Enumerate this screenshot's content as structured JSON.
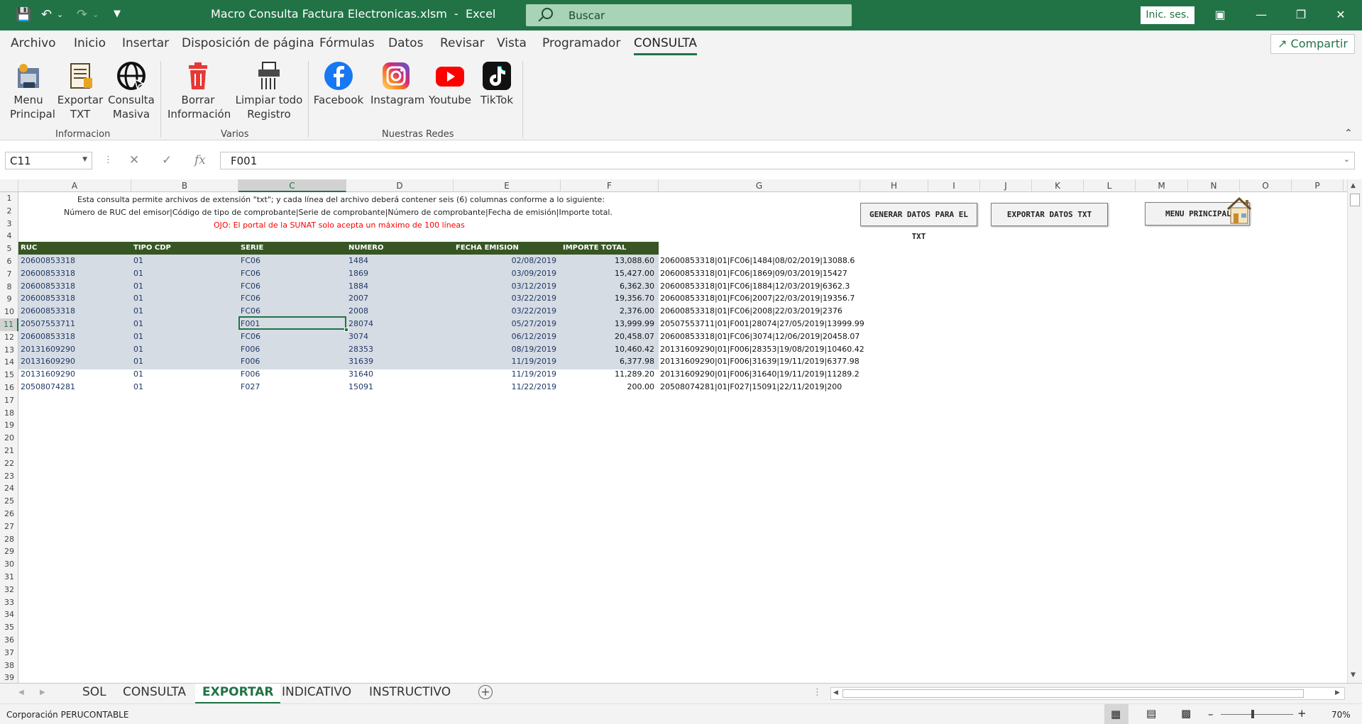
{
  "titlebar": {
    "filename": "Macro Consulta Factura Electronicas.xlsm",
    "separator": "-",
    "app": "Excel",
    "search_placeholder": "Buscar",
    "signin": "Inic. ses."
  },
  "menu": {
    "items": [
      "Archivo",
      "Inicio",
      "Insertar",
      "Disposición de página",
      "Fórmulas",
      "Datos",
      "Revisar",
      "Vista",
      "Programador",
      "CONSULTA"
    ],
    "share": "Compartir"
  },
  "ribbon": {
    "buttons": [
      {
        "l1": "Menu",
        "l2": "Principal"
      },
      {
        "l1": "Exportar",
        "l2": "TXT"
      },
      {
        "l1": "Consulta",
        "l2": "Masiva"
      },
      {
        "l1": "Borrar",
        "l2": "Información"
      },
      {
        "l1": "Limpiar todo",
        "l2": "Registro"
      },
      {
        "l1": "Facebook",
        "l2": ""
      },
      {
        "l1": "Instagram",
        "l2": ""
      },
      {
        "l1": "Youtube",
        "l2": ""
      },
      {
        "l1": "TikTok",
        "l2": ""
      }
    ],
    "groups": [
      "Informacion",
      "Varios",
      "Nuestras Redes"
    ]
  },
  "formula": {
    "namebox": "C11",
    "value": "F001",
    "fx": "fx"
  },
  "columns": [
    "A",
    "B",
    "C",
    "D",
    "E",
    "F",
    "G",
    "H",
    "I",
    "J",
    "K",
    "L",
    "M",
    "N",
    "O",
    "P"
  ],
  "rows": [
    "1",
    "2",
    "3",
    "4",
    "5",
    "6",
    "7",
    "8",
    "9",
    "10",
    "11",
    "12",
    "13",
    "14",
    "15",
    "16",
    "17",
    "18",
    "19",
    "20",
    "21",
    "22",
    "23",
    "24",
    "25",
    "26",
    "27",
    "28",
    "29",
    "30",
    "31",
    "32",
    "33",
    "34",
    "35",
    "36",
    "37",
    "38",
    "39"
  ],
  "sheet": {
    "info1": "Esta consulta permite archivos de extensión \"txt\"; y cada línea del archivo deberá contener seis (6) columnas conforme a lo siguiente:",
    "info2": "Número de RUC del emisor|Código de tipo de comprobante|Serie de comprobante|Número de comprobante|Fecha de emisión|Importe total.",
    "warning": "OJO: El portal de la SUNAT solo acepta un máximo de 100 líneas",
    "headers": [
      "RUC",
      "TIPO CDP",
      "SERIE",
      "NUMERO",
      "FECHA EMISION",
      "IMPORTE TOTAL"
    ],
    "data": [
      [
        "20600853318",
        "01",
        "FC06",
        "1484",
        "02/08/2019",
        "13,088.60",
        "20600853318|01|FC06|1484|08/02/2019|13088.6"
      ],
      [
        "20600853318",
        "01",
        "FC06",
        "1869",
        "03/09/2019",
        "15,427.00",
        "20600853318|01|FC06|1869|09/03/2019|15427"
      ],
      [
        "20600853318",
        "01",
        "FC06",
        "1884",
        "03/12/2019",
        "6,362.30",
        "20600853318|01|FC06|1884|12/03/2019|6362.3"
      ],
      [
        "20600853318",
        "01",
        "FC06",
        "2007",
        "03/22/2019",
        "19,356.70",
        "20600853318|01|FC06|2007|22/03/2019|19356.7"
      ],
      [
        "20600853318",
        "01",
        "FC06",
        "2008",
        "03/22/2019",
        "2,376.00",
        "20600853318|01|FC06|2008|22/03/2019|2376"
      ],
      [
        "20507553711",
        "01",
        "F001",
        "28074",
        "05/27/2019",
        "13,999.99",
        "20507553711|01|F001|28074|27/05/2019|13999.99"
      ],
      [
        "20600853318",
        "01",
        "FC06",
        "3074",
        "06/12/2019",
        "20,458.07",
        "20600853318|01|FC06|3074|12/06/2019|20458.07"
      ],
      [
        "20131609290",
        "01",
        "F006",
        "28353",
        "08/19/2019",
        "10,460.42",
        "20131609290|01|F006|28353|19/08/2019|10460.42"
      ],
      [
        "20131609290",
        "01",
        "F006",
        "31639",
        "11/19/2019",
        "6,377.98",
        "20131609290|01|F006|31639|19/11/2019|6377.98"
      ],
      [
        "20131609290",
        "01",
        "F006",
        "31640",
        "11/19/2019",
        "11,289.20",
        "20131609290|01|F006|31640|19/11/2019|11289.2"
      ],
      [
        "20508074281",
        "01",
        "F027",
        "15091",
        "11/22/2019",
        "200.00",
        "20508074281|01|F027|15091|22/11/2019|200"
      ]
    ],
    "buttons": [
      "GENERAR DATOS PARA EL TXT",
      "EXPORTAR DATOS TXT",
      "MENU PRINCIPAL"
    ]
  },
  "tabs": [
    "SOL",
    "CONSULTA",
    "EXPORTAR",
    "INDICATIVO",
    "INSTRUCTIVO"
  ],
  "active_tab": "EXPORTAR",
  "status": {
    "text": "Corporación PERUCONTABLE",
    "zoom": "70%"
  },
  "colors": {
    "excel_green": "#217346",
    "header_green": "#375623",
    "shade": "#d6dce4",
    "blue_text": "#1f3864",
    "warning": "#ff0000"
  }
}
